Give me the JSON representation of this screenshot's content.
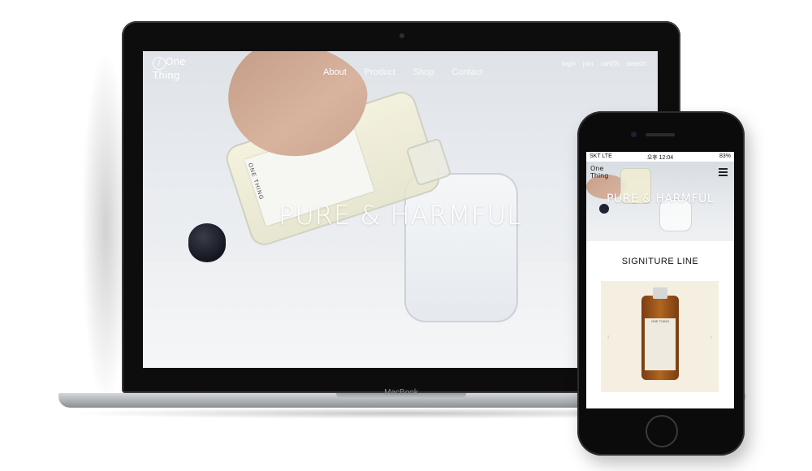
{
  "desktop_site": {
    "logo_top": "One",
    "logo_bottom": "Thing",
    "nav": [
      "About",
      "Product",
      "Shop",
      "Contact"
    ],
    "utility": [
      "login",
      "join",
      "cart(0)",
      "search"
    ],
    "hero_title": "PURE & HARMFUL",
    "bottle_label": "ONE THING"
  },
  "device": {
    "brand": "MacBook"
  },
  "mobile_site": {
    "status_carrier": "SKT  LTE",
    "status_time": "오후 12:04",
    "status_battery": "83%",
    "logo_top": "One",
    "logo_bottom": "Thing",
    "hero_title": "PURE & HARMFUL",
    "section_title": "SIGNITURE LINE",
    "product_label": "ONE THING",
    "carousel_prev": "‹",
    "carousel_next": "›"
  }
}
